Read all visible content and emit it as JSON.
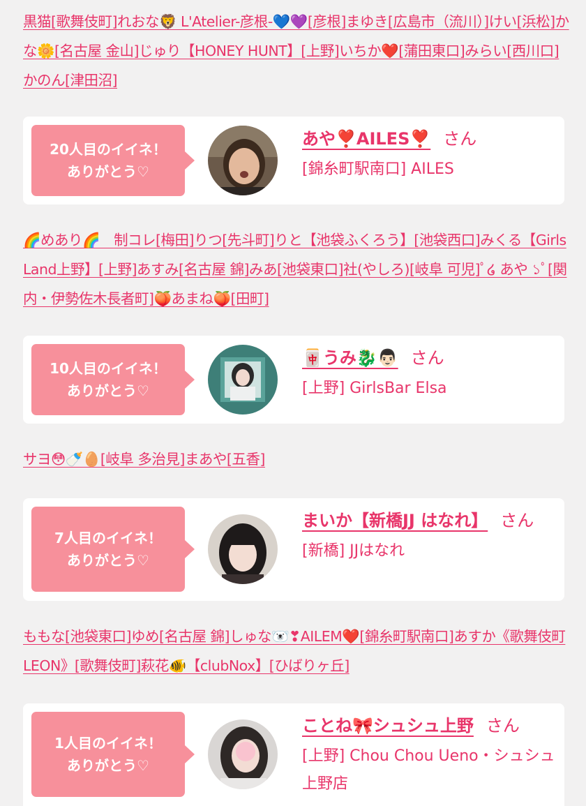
{
  "likers_1": [
    "黒猫[歌舞伎町]",
    "れおな🦁 L'Atelier-彦根-💙💜[彦根]",
    "まゆき[広島市（流川）]",
    "けい[浜松]",
    "かな🌼[名古屋 金山]",
    "じゅり【HONEY HUNT】[上野]",
    "いちか❤️[蒲田東口]",
    "みらい[西川口]",
    "かのん[津田沼]"
  ],
  "likers_2": [
    "🌈めあり🌈　",
    "制コレ[梅田]",
    "りつ[先斗町]",
    "りと【池袋ふくろう】[池袋西口]",
    "みくる【Girls Land上野】[上野]",
    "あすみ[名古屋 錦]",
    "みあ[池袋東口]",
    "社(やしろ)[岐阜 可児]",
    "ﾟ໒ あや ১ﾟ[関内・伊勢佐木長者町]",
    "🍑あまね🍑[田町]"
  ],
  "likers_3": [
    "サヨ😳🍼🥚[岐阜 多治見]",
    "まあや[五香]"
  ],
  "likers_4": [
    "ももな[池袋東口]",
    "ゆめ[名古屋 錦]",
    "しゅな🐻‍❄️❣AILEM❤️[錦糸町駅南口]",
    "あすか《歌舞伎町LEON》[歌舞伎町]",
    "萩花🐠【clubNox】[ひばりヶ丘]"
  ],
  "cards": [
    {
      "bubble_line1": "20人目のイイネ！",
      "bubble_line2": "ありがとう♡",
      "name": "あや❣️AILES❣️",
      "san": "さん",
      "shop": "[錦糸町駅南口] AILES"
    },
    {
      "bubble_line1": "10人目のイイネ！",
      "bubble_line2": "ありがとう♡",
      "name": "🀄うみ🐉👨🏻",
      "san": "さん",
      "shop": "[上野] GirlsBar Elsa"
    },
    {
      "bubble_line1": "7人目のイイネ！",
      "bubble_line2": "ありがとう♡",
      "name": "まいか【新橋JJ はなれ】",
      "san": "さん",
      "shop": "[新橋] JJはなれ"
    },
    {
      "bubble_line1": "1人目のイイネ！",
      "bubble_line2": "ありがとう♡",
      "name": "ことね🎀シュシュ上野",
      "san": "さん",
      "shop": "[上野] Chou Chou Ueno・シュシュ上野店"
    }
  ]
}
